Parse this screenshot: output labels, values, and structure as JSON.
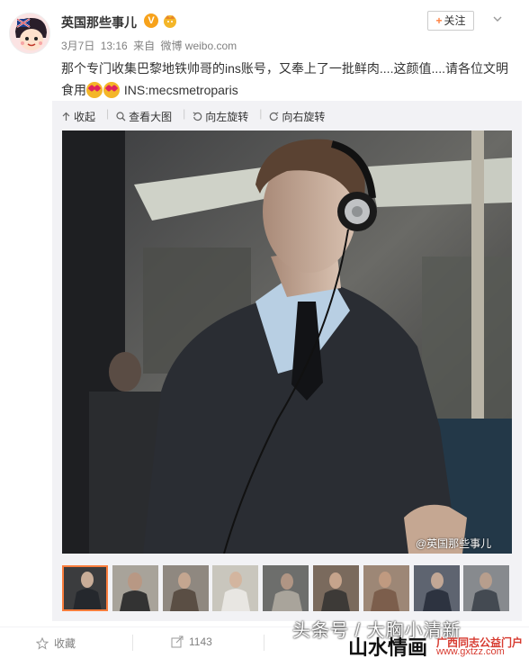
{
  "post": {
    "username": "英国那些事儿",
    "verified_badge": "V",
    "date": "3月7日",
    "time": "13:16",
    "source_prefix": "来自",
    "source": "微博 weibo.com",
    "follow_label": "关注",
    "text_main": "那个专门收集巴黎地铁帅哥的ins账号，又奉上了一批鲜肉....这颜值....请各位文明食用",
    "text_ins": "INS:mecsmetroparis"
  },
  "media_toolbar": {
    "collapse": "收起",
    "view_large": "查看大图",
    "rotate_left": "向左旋转",
    "rotate_right": "向右旋转"
  },
  "photo": {
    "watermark": "@英国那些事儿"
  },
  "thumbnails_count": 9,
  "actions": {
    "favorite": "收藏",
    "repost_count": "1143"
  },
  "overlay": {
    "platform_text": "头条号 / 大胸小清新",
    "logo_text": "山水情画",
    "site_name": "广西同志公益门户",
    "site_url": "www.gxtzz.com"
  },
  "colors": {
    "accent_orange": "#fa7d3c",
    "follow_plus": "#ff8140",
    "verified": "#f7a21b"
  }
}
